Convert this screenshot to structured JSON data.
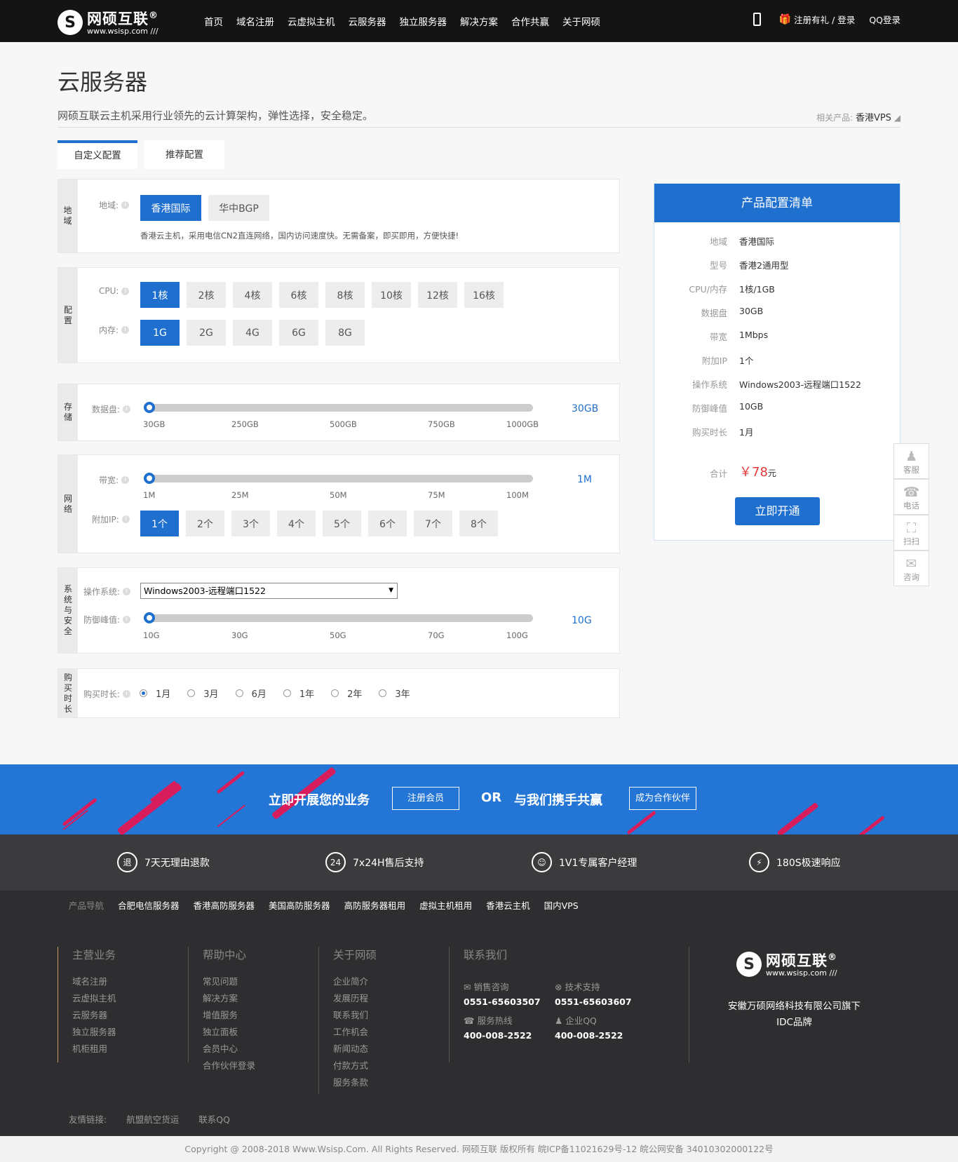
{
  "header": {
    "logo_name": "网硕互联",
    "logo_reg": "®",
    "logo_url": "www.wsisp.com ///",
    "nav": [
      "首页",
      "域名注册",
      "云虚拟主机",
      "云服务器",
      "独立服务器",
      "解决方案",
      "合作共赢",
      "关于网硕"
    ],
    "register": "注册有礼 / 登录",
    "qq_login": "QQ登录"
  },
  "page": {
    "title": "云服务器",
    "desc": "网硕互联云主机采用行业领先的云计算架构，弹性选择，安全稳定。",
    "related_label": "相关产品:",
    "related_value": "香港VPS"
  },
  "tabs": [
    "自定义配置",
    "推荐配置"
  ],
  "region": {
    "side": "地域",
    "label": "地域:",
    "options": [
      "香港国际",
      "华中BGP"
    ],
    "selected": 0,
    "note": "香港云主机，采用电信CN2直连网络，国内访问速度快。无需备案，即买即用，方便快捷!"
  },
  "config": {
    "side": "配置",
    "cpu_label": "CPU:",
    "cpu_options": [
      "1核",
      "2核",
      "4核",
      "6核",
      "8核",
      "10核",
      "12核",
      "16核"
    ],
    "cpu_selected": 0,
    "mem_label": "内存:",
    "mem_options": [
      "1G",
      "2G",
      "4G",
      "6G",
      "8G"
    ],
    "mem_selected": 0
  },
  "storage": {
    "side": "存储",
    "label": "数据盘:",
    "ticks": [
      "30GB",
      "250GB",
      "500GB",
      "750GB",
      "1000GB"
    ],
    "value": "30GB",
    "level": 0
  },
  "network": {
    "side": "网络",
    "bw_label": "带宽:",
    "bw_ticks": [
      "1M",
      "25M",
      "50M",
      "75M",
      "100M"
    ],
    "bw_value": "1M",
    "bw_level": 0,
    "ip_label": "附加IP:",
    "ip_options": [
      "1个",
      "2个",
      "3个",
      "4个",
      "5个",
      "6个",
      "7个",
      "8个"
    ],
    "ip_selected": 0
  },
  "system": {
    "side": "系统与安全",
    "os_label": "操作系统:",
    "os_value": "Windows2003-远程端口1522",
    "ddos_label": "防御峰值:",
    "ddos_ticks": [
      "10G",
      "30G",
      "50G",
      "70G",
      "100G"
    ],
    "ddos_value": "10G",
    "ddos_level": 0
  },
  "duration": {
    "side": "购买时长",
    "label": "购买时长:",
    "options": [
      "1月",
      "3月",
      "6月",
      "1年",
      "2年",
      "3年"
    ],
    "selected": 0
  },
  "summary": {
    "title": "产品配置清单",
    "rows": [
      [
        "地域",
        "香港国际"
      ],
      [
        "型号",
        "香港2通用型"
      ],
      [
        "CPU/内存",
        "1核/1GB"
      ],
      [
        "数据盘",
        "30GB"
      ],
      [
        "带宽",
        "1Mbps"
      ],
      [
        "附加IP",
        "1个"
      ],
      [
        "操作系统",
        "Windows2003-远程端口1522"
      ],
      [
        "防御峰值",
        "10GB"
      ],
      [
        "购买时长",
        "1月"
      ]
    ],
    "total_label": "合计",
    "total_value": "￥78",
    "total_unit": "元",
    "button": "立即开通"
  },
  "float_bar": [
    "客服",
    "电话",
    "扫扫",
    "咨询"
  ],
  "banner": {
    "text1": "立即开展您的业务",
    "btn1": "注册会员",
    "or": "OR",
    "text2": "与我们携手共赢",
    "btn2": "成为合作伙伴"
  },
  "features": [
    {
      "icon": "退",
      "text": "7天无理由退款"
    },
    {
      "icon": "24",
      "text": "7x24H售后支持"
    },
    {
      "icon": "☺",
      "text": "1V1专属客户经理"
    },
    {
      "icon": "⚡",
      "text": "180S极速响应"
    }
  ],
  "product_nav": {
    "label": "产品导航",
    "items": [
      "合肥电信服务器",
      "香港高防服务器",
      "美国高防服务器",
      "高防服务器租用",
      "虚拟主机租用",
      "香港云主机",
      "国内VPS"
    ]
  },
  "footer": {
    "cols": [
      {
        "title": "主营业务",
        "items": [
          "域名注册",
          "云虚拟主机",
          "云服务器",
          "独立服务器",
          "机柜租用"
        ]
      },
      {
        "title": "帮助中心",
        "items": [
          "常见问题",
          "解决方案",
          "增值服务",
          "独立面板",
          "会员中心",
          "合作伙伴登录"
        ]
      },
      {
        "title": "关于网硕",
        "items": [
          "企业简介",
          "发展历程",
          "联系我们",
          "工作机会",
          "新闻动态",
          "付款方式",
          "服务条款"
        ]
      }
    ],
    "contact_title": "联系我们",
    "sales_label": "销售咨询",
    "sales_phone": "0551-65603507",
    "tech_label": "技术支持",
    "tech_phone": "0551-65603607",
    "hotline_label": "服务热线",
    "hotline": "400-008-2522",
    "qq_label": "企业QQ",
    "qq": "400-008-2522",
    "company": "安徽万硕网络科技有限公司旗下",
    "brand": "IDC品牌"
  },
  "links": {
    "label": "友情链接:",
    "items": [
      "航盟航空货运",
      "联系QQ"
    ]
  },
  "copyright": "Copyright @ 2008-2018 Www.Wsisp.Com. All Rights Reserved. 网硕互联 版权所有 皖ICP备11021629号-12 皖公网安备 34010302000122号"
}
